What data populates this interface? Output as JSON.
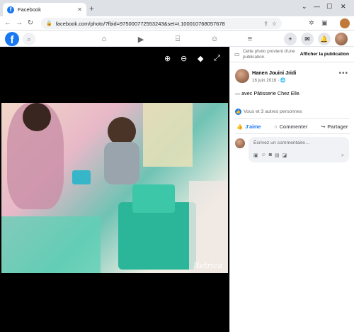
{
  "browser": {
    "tab_title": "Facebook",
    "tab_close": "✕",
    "new_tab": "+",
    "window_controls": [
      "⌄",
      "—",
      "☐",
      "✕"
    ],
    "url": "facebook.com/photo/?fbid=975000772553243&set=t.100010768057678",
    "nav": {
      "back": "←",
      "forward": "→",
      "reload": "↻"
    }
  },
  "facebook": {
    "logo": "f",
    "nav_icons": [
      "home-icon",
      "watch-icon",
      "marketplace-icon",
      "groups-icon",
      "menu-icon"
    ]
  },
  "photo": {
    "watermark": "Retrica",
    "viewer_tools": [
      "zoom-in-icon",
      "zoom-out-icon",
      "tag-icon",
      "fullscreen-icon"
    ]
  },
  "panel": {
    "notice_text": "Cette photo provient d'une publication.",
    "notice_link": "Afficher la publication",
    "author": "Hanen Jouini Jridi",
    "date": "16 juin 2016 · ",
    "caption": "— avec Pâtisserie Chez Elle.",
    "reactions": "Vous et 3 autres personnes",
    "actions": {
      "like": "J'aime",
      "comment": "Commenter",
      "share": "Partager"
    },
    "comment_placeholder": "Écrivez un commentaire…"
  },
  "colors": {
    "facebook_blue": "#1877f2",
    "viewer_bg": "#000000",
    "panel_bg": "#ffffff"
  }
}
